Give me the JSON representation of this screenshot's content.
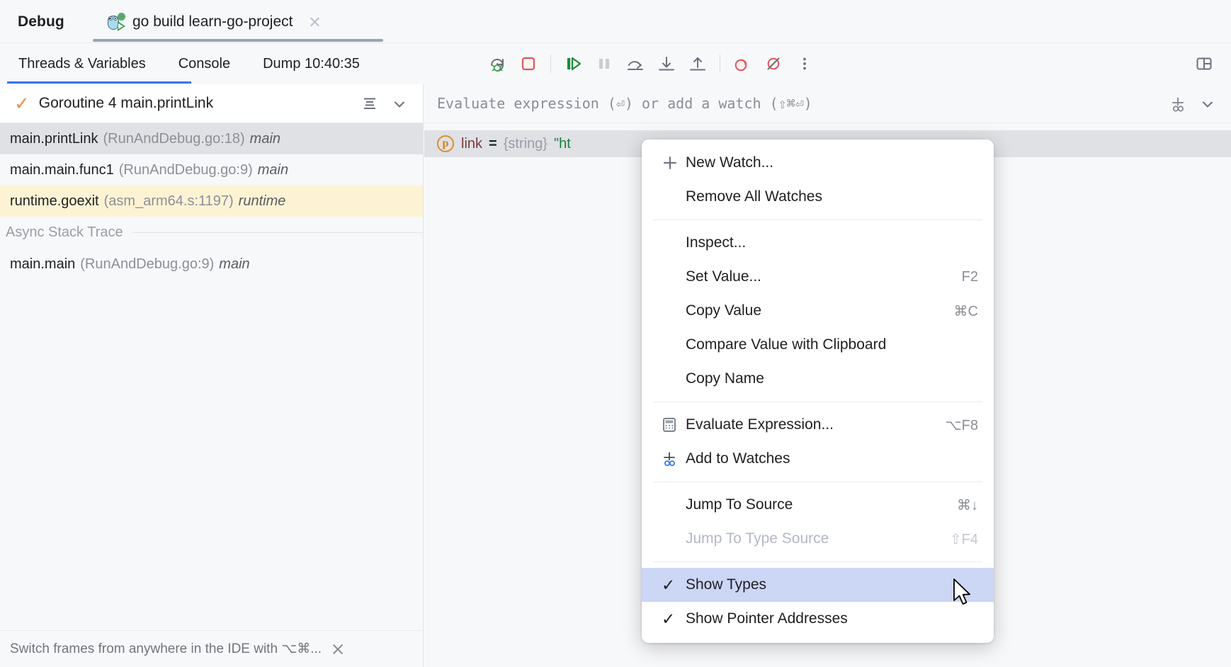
{
  "window": {
    "panel_label": "Debug",
    "run_tab": {
      "title": "go build learn-go-project",
      "icon": "go-gopher-icon",
      "close_icon": "close-icon"
    }
  },
  "view_tabs": [
    {
      "label": "Threads & Variables",
      "selected": true
    },
    {
      "label": "Console",
      "selected": false
    },
    {
      "label": "Dump 10:40:35",
      "selected": false
    }
  ],
  "toolbar": {
    "buttons": [
      {
        "name": "rerun-debug-icon",
        "tooltip": "Rerun"
      },
      {
        "name": "stop-icon",
        "tooltip": "Stop"
      },
      {
        "name": "resume-program-icon",
        "tooltip": "Resume Program"
      },
      {
        "name": "pause-program-icon",
        "tooltip": "Pause Program"
      },
      {
        "name": "step-over-icon",
        "tooltip": "Step Over"
      },
      {
        "name": "step-into-icon",
        "tooltip": "Step Into"
      },
      {
        "name": "step-out-icon",
        "tooltip": "Step Out"
      },
      {
        "name": "view-breakpoints-icon",
        "tooltip": "View Breakpoints"
      },
      {
        "name": "mute-breakpoints-icon",
        "tooltip": "Mute Breakpoints"
      },
      {
        "name": "more-options-icon",
        "tooltip": "More"
      }
    ],
    "layout_settings_icon": "layout-settings-icon"
  },
  "frames_panel": {
    "thread_selector": {
      "status_icon": "orange-check-icon",
      "label": "Goroutine 4 main.printLink",
      "list_icon": "frames-list-icon",
      "chevron_icon": "chevron-down-icon"
    },
    "frames": [
      {
        "fn": "main.printLink",
        "loc": "(RunAndDebug.go:18)",
        "module": "main",
        "state": "selected"
      },
      {
        "fn": "main.main.func1",
        "loc": "(RunAndDebug.go:9)",
        "module": "main",
        "state": "normal"
      },
      {
        "fn": "runtime.goexit",
        "loc": "(asm_arm64.s:1197)",
        "module": "runtime",
        "state": "runtime"
      }
    ],
    "async_section_label": "Async Stack Trace",
    "async_frames": [
      {
        "fn": "main.main",
        "loc": "(RunAndDebug.go:9)",
        "module": "main",
        "state": "normal"
      }
    ],
    "hint": {
      "text": "Switch frames from anywhere in the IDE with ⌥⌘...",
      "close_icon": "close-icon"
    }
  },
  "watches_panel": {
    "eval_placeholder": "Evaluate expression (⏎) or add a watch (⇧⌘⏎)",
    "add_watch_icon": "add-to-watches-icon",
    "chevron_icon": "chevron-down-icon",
    "rows": [
      {
        "badge": "p",
        "name": "link",
        "eq": "=",
        "type": "{string}",
        "value": "\"ht"
      }
    ]
  },
  "context_menu": {
    "items": [
      {
        "icon": "plus-icon",
        "label": "New Watch...",
        "shortcut": "",
        "state": "normal"
      },
      {
        "icon": "",
        "label": "Remove All Watches",
        "shortcut": "",
        "state": "normal"
      },
      {
        "separator": true
      },
      {
        "icon": "",
        "label": "Inspect...",
        "shortcut": "",
        "state": "normal"
      },
      {
        "icon": "",
        "label": "Set Value...",
        "shortcut": "F2",
        "state": "normal"
      },
      {
        "icon": "",
        "label": "Copy Value",
        "shortcut": "⌘C",
        "state": "normal"
      },
      {
        "icon": "",
        "label": "Compare Value with Clipboard",
        "shortcut": "",
        "state": "normal"
      },
      {
        "icon": "",
        "label": "Copy Name",
        "shortcut": "",
        "state": "normal"
      },
      {
        "separator": true
      },
      {
        "icon": "calculator-icon",
        "label": "Evaluate Expression...",
        "shortcut": "⌥F8",
        "state": "normal"
      },
      {
        "icon": "add-to-watches-icon",
        "label": "Add to Watches",
        "shortcut": "",
        "state": "normal"
      },
      {
        "separator": true
      },
      {
        "icon": "",
        "label": "Jump To Source",
        "shortcut": "⌘↓",
        "state": "normal"
      },
      {
        "icon": "",
        "label": "Jump To Type Source",
        "shortcut": "⇧F4",
        "state": "disabled"
      },
      {
        "separator": true
      },
      {
        "icon": "check-icon",
        "label": "Show Types",
        "shortcut": "",
        "state": "highlight"
      },
      {
        "icon": "check-icon",
        "label": "Show Pointer Addresses",
        "shortcut": "",
        "state": "checked"
      }
    ]
  },
  "colors": {
    "accent": "#3574f0",
    "menu_highlight": "#ccd6f5",
    "runtime_row": "#fdf3d4",
    "selected_row": "#dfe1e5",
    "status_check": "#ef8d4f",
    "string_value": "#1a7f37",
    "stop_red": "#e05555",
    "resume_green": "#1f8a35"
  }
}
